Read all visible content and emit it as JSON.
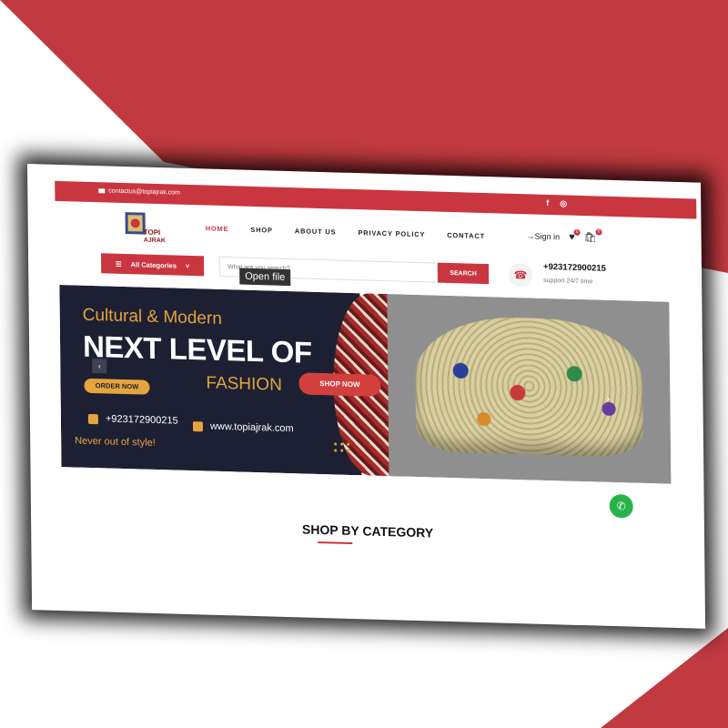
{
  "topbar": {
    "email": "contactus@topiajrak.com",
    "social_icons": [
      "facebook-icon",
      "instagram-icon"
    ]
  },
  "logo": {
    "text_line1": "TOPI",
    "text_line2": "AJRAK"
  },
  "nav": {
    "items": [
      "HOME",
      "SHOP",
      "ABOUT US",
      "PRIVACY POLICY",
      "CONTACT"
    ],
    "active": "HOME"
  },
  "header_right": {
    "signin": "Sign in",
    "wishlist_count": "0",
    "cart_count": "0"
  },
  "search": {
    "categories_label": "All Categories",
    "placeholder": "What are you search?",
    "button": "SEARCH",
    "tooltip": "Open file"
  },
  "contact": {
    "phone": "+923172900215",
    "support": "support 24/7 time"
  },
  "banner": {
    "line1": "Cultural & Modern",
    "line2": "NEXT LEVEL OF",
    "order_button": "ORDER NOW",
    "line3": "FASHION",
    "shop_button": "SHOP NOW",
    "phone": "+923172900215",
    "website": "www.topiajrak.com",
    "tagline": "Never out of style!"
  },
  "section": {
    "title": "SHOP BY CATEGORY"
  },
  "colors": {
    "brand_red": "#c9363f",
    "banner_dark": "#1d2033",
    "banner_gold": "#e5a43c",
    "whatsapp_green": "#26b34a"
  }
}
